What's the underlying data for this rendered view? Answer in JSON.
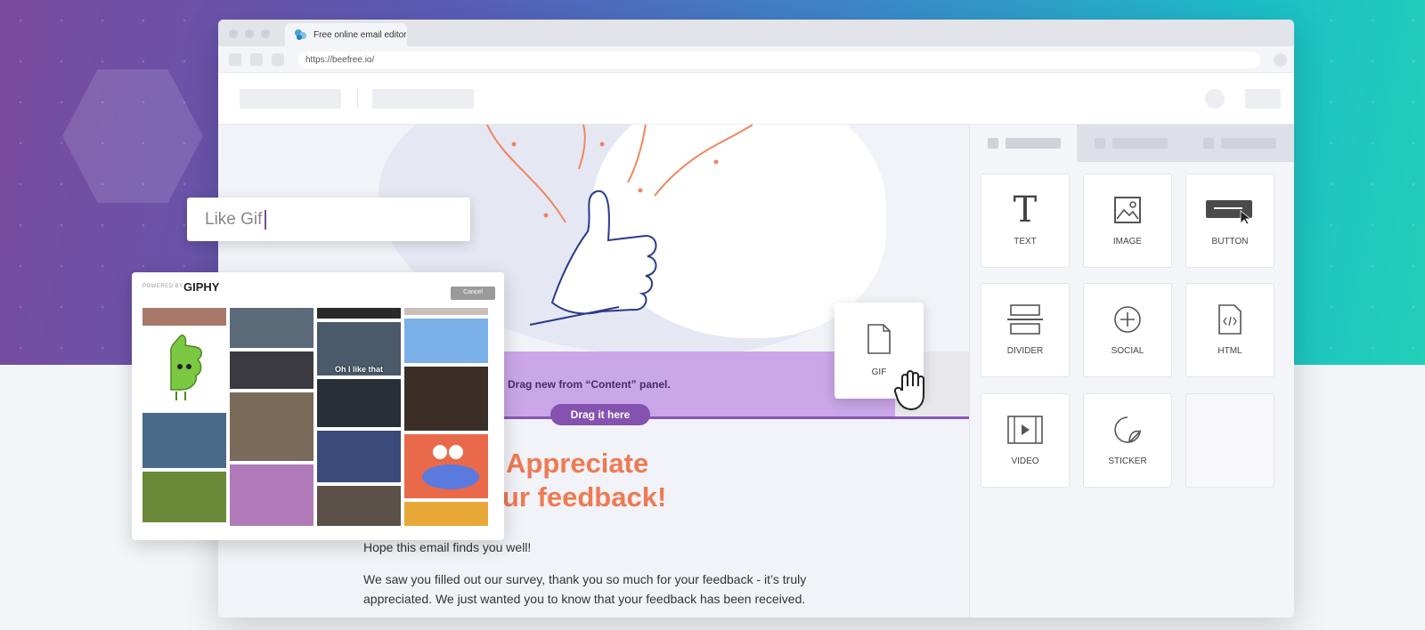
{
  "browser": {
    "tab_title": "Free online email editor",
    "url": "https://beefree.io/"
  },
  "search": {
    "value": "Like Gif"
  },
  "giphy": {
    "powered_by": "POWERED BY",
    "brand": "GIPHY",
    "cancel_label": "Cancel",
    "captions": [
      "Oh I like that"
    ]
  },
  "canvas": {
    "drop_text": "Drag new from “Content” panel.",
    "drag_pill": "Drag it here",
    "headline_line1": "Appreciate",
    "headline_line2": "our feedback!",
    "paragraph1": "Hope this email finds you well!",
    "paragraph2": "We saw you filled out our survey, thank you so much for your feedback - it’s truly appreciated. We just wanted you to know that your feedback has been received."
  },
  "drag_card": {
    "label": "GIF",
    "icon": "file-icon"
  },
  "content_blocks": [
    {
      "label": "TEXT",
      "icon": "text-icon"
    },
    {
      "label": "IMAGE",
      "icon": "image-icon"
    },
    {
      "label": "BUTTON",
      "icon": "button-icon"
    },
    {
      "label": "DIVIDER",
      "icon": "divider-icon"
    },
    {
      "label": "SOCIAL",
      "icon": "social-icon"
    },
    {
      "label": "HTML",
      "icon": "html-icon"
    },
    {
      "label": "VIDEO",
      "icon": "video-icon"
    },
    {
      "label": "STICKER",
      "icon": "sticker-icon"
    }
  ],
  "colors": {
    "accent_purple": "#8552b0",
    "dropzone": "#cba6e8",
    "headline": "#ef7a52"
  }
}
